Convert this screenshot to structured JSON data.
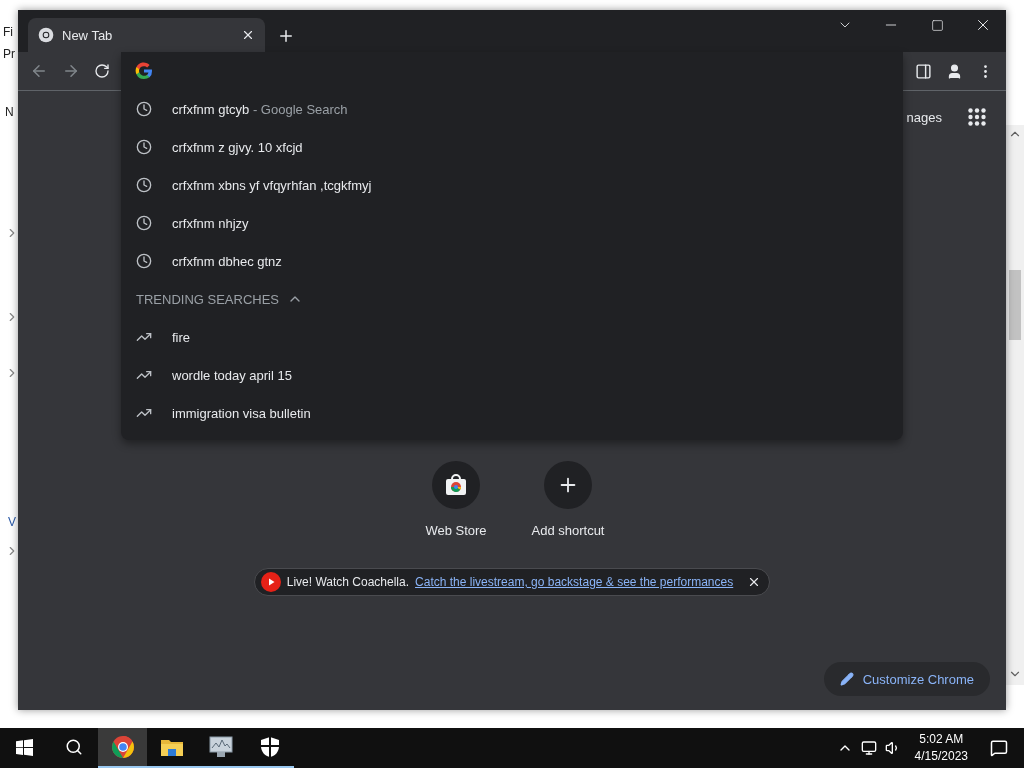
{
  "background_window": {
    "fragments": [
      {
        "text": "Fi",
        "kind": "menu"
      },
      {
        "text": "Pr",
        "kind": "tab"
      },
      {
        "text": "N",
        "kind": "header"
      },
      {
        "text": "V",
        "kind": "link"
      }
    ]
  },
  "browser": {
    "tabs": [
      {
        "title": "New Tab",
        "selected": true
      }
    ],
    "dropdown": {
      "recent": [
        {
          "text": "crfxfnm gtcyb",
          "suffix": "- Google Search"
        },
        {
          "text": "crfxfnm z gjvy. 10 xfcjd"
        },
        {
          "text": "crfxfnm xbns yf vfqyrhfan ,tcgkfmyj"
        },
        {
          "text": "crfxfnm nhjzy"
        },
        {
          "text": "crfxfnm dbhec gtnz"
        }
      ],
      "trending_header": "TRENDING SEARCHES",
      "trending_expanded": true,
      "trending": [
        {
          "text": "fire"
        },
        {
          "text": "wordle today april 15"
        },
        {
          "text": "immigration visa bulletin"
        }
      ]
    },
    "images_link": "nages",
    "shortcuts": [
      {
        "label": "Web Store",
        "kind": "store"
      },
      {
        "label": "Add shortcut",
        "kind": "add"
      }
    ],
    "promo": {
      "text": "Live! Watch Coachella.",
      "link": "Catch the livestream, go backstage & see the performances"
    },
    "customize": "Customize Chrome"
  },
  "taskbar": {
    "apps": [
      {
        "kind": "chrome",
        "selected": true
      },
      {
        "kind": "folder",
        "selected": false
      },
      {
        "kind": "monitor",
        "selected": false
      },
      {
        "kind": "shield",
        "selected": false
      }
    ],
    "time": "5:02 AM",
    "date": "4/15/2023"
  }
}
